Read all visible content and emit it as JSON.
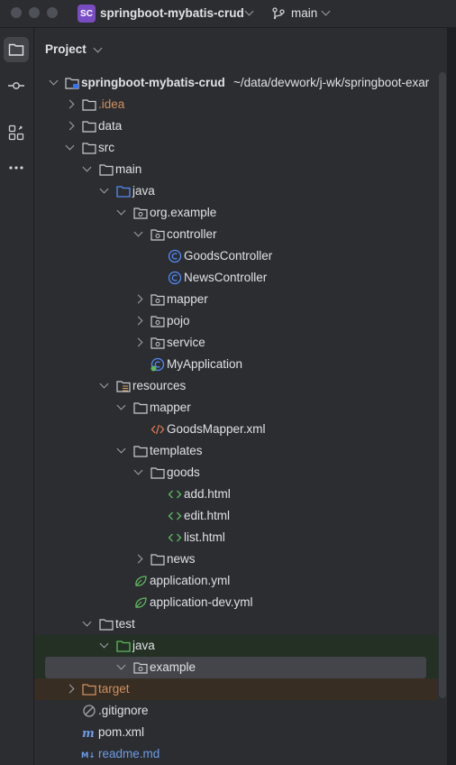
{
  "window": {
    "project_badge": "SC",
    "project_name": "springboot-mybatis-crud",
    "branch": "main"
  },
  "toolstrip": {
    "items": [
      "project-icon",
      "commit-icon",
      "structure-icon",
      "more-icon"
    ]
  },
  "panel": {
    "title": "Project"
  },
  "tree": {
    "root": {
      "label": "springboot-mybatis-crud",
      "hint": "~/data/devwork/j-wk/springboot-exar"
    },
    "rows": [
      {
        "label": ".idea"
      },
      {
        "label": "data"
      },
      {
        "label": "src"
      },
      {
        "label": "main"
      },
      {
        "label": "java"
      },
      {
        "label": "org.example"
      },
      {
        "label": "controller"
      },
      {
        "label": "GoodsController"
      },
      {
        "label": "NewsController"
      },
      {
        "label": "mapper"
      },
      {
        "label": "pojo"
      },
      {
        "label": "service"
      },
      {
        "label": "MyApplication"
      },
      {
        "label": "resources"
      },
      {
        "label": "mapper"
      },
      {
        "label": "GoodsMapper.xml"
      },
      {
        "label": "templates"
      },
      {
        "label": "goods"
      },
      {
        "label": "add.html"
      },
      {
        "label": "edit.html"
      },
      {
        "label": "list.html"
      },
      {
        "label": "news"
      },
      {
        "label": "application.yml"
      },
      {
        "label": "application-dev.yml"
      },
      {
        "label": "test"
      },
      {
        "label": "java"
      },
      {
        "label": "example"
      },
      {
        "label": "target"
      },
      {
        "label": ".gitignore"
      },
      {
        "label": "pom.xml"
      },
      {
        "label": "readme.md"
      }
    ]
  },
  "colors": {
    "background": "#2b2d30",
    "accent_badge": "#7a4cc3",
    "folder_blue": "#548af7",
    "excluded_orange": "#d09060",
    "test_green": "#5fb85f",
    "selection": "#43454a"
  }
}
